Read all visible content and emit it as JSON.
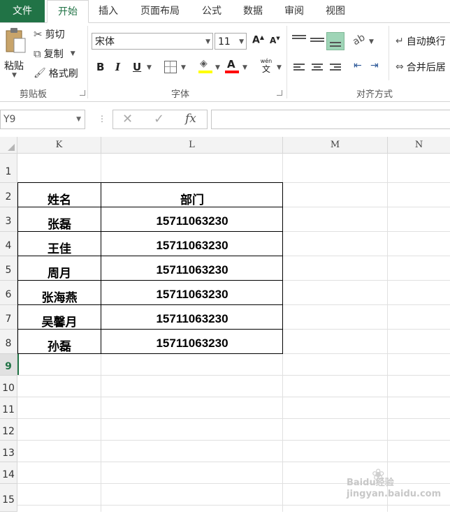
{
  "tabs": {
    "file": "文件",
    "items": [
      "开始",
      "插入",
      "页面布局",
      "公式",
      "数据",
      "审阅",
      "视图"
    ]
  },
  "clipboard": {
    "paste": "粘贴",
    "cut": "剪切",
    "copy": "复制",
    "format_painter": "格式刷",
    "group_label": "剪贴板"
  },
  "font": {
    "name": "宋体",
    "size": "11",
    "bold": "B",
    "italic": "I",
    "underline": "U",
    "group_label": "字体",
    "wen_top": "wén",
    "wen_bottom": "文"
  },
  "alignment": {
    "wrap_text": "自动换行",
    "merge_center": "合并后居",
    "group_label": "对齐方式"
  },
  "formula_bar": {
    "name_box": "Y9",
    "fx": "fx",
    "formula": ""
  },
  "sheet": {
    "columns": [
      "K",
      "L",
      "M",
      "N"
    ],
    "rows": [
      "1",
      "2",
      "3",
      "4",
      "5",
      "6",
      "7",
      "8",
      "9",
      "10",
      "11",
      "12",
      "13",
      "14",
      "15"
    ],
    "selected_row": "9",
    "table": {
      "headers": [
        "姓名",
        "部门"
      ],
      "rows": [
        [
          "张磊",
          "15711063230"
        ],
        [
          "王佳",
          "15711063230"
        ],
        [
          "周月",
          "15711063230"
        ],
        [
          "张海燕",
          "15711063230"
        ],
        [
          "吴馨月",
          "15711063230"
        ],
        [
          "孙磊",
          "15711063230"
        ]
      ]
    }
  },
  "watermark": "Baidu经验 jingyan.baidu.com",
  "colors": {
    "accent": "#217346",
    "highlight": "#ffff00",
    "font_color": "#ff0000"
  }
}
